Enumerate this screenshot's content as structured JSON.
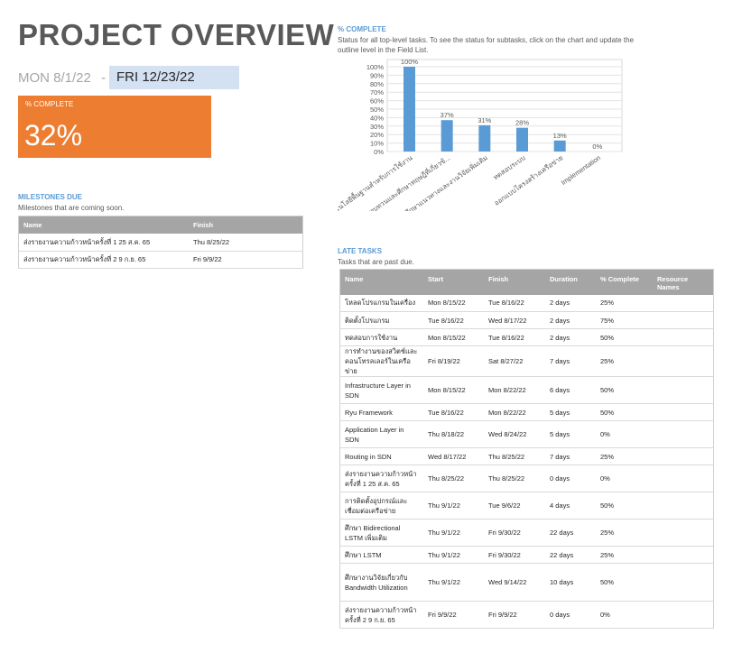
{
  "header": {
    "title": "PROJECT OVERVIEW",
    "start_date": "MON 8/1/22",
    "separator": "-",
    "finish_date": "FRI 12/23/22"
  },
  "percent_card": {
    "label": "% COMPLETE",
    "value": "32%"
  },
  "milestones": {
    "title": "MILESTONES DUE",
    "subtitle": "Milestones that are coming soon.",
    "columns": [
      "Name",
      "Finish"
    ],
    "rows": [
      [
        "ส่งรายงานความก้าวหน้าครั้งที่ 1 25 ส.ค. 65",
        "Thu 8/25/22"
      ],
      [
        "ส่งรายงานความก้าวหน้าครั้งที่ 2 9 ก.ย. 65",
        "Fri 9/9/22"
      ]
    ]
  },
  "complete_section": {
    "title": "% COMPLETE",
    "subtitle": "Status for all top-level tasks. To see the status for subtasks, click on the chart and update the outline level in the Field List."
  },
  "chart_data": {
    "type": "bar",
    "categories": [
      "ศึกษาเทคโนโลยีพื้นฐานสำหรับการใช้งาน",
      "ทบทวนและศึกษาทฤษฎีที่เกี่ยวข้...",
      "ศึกษาแนวทางและงานวิจัยเพิ่มเติม",
      "ทดสอบระบบ",
      "ออกแบบโครงสร้างเครือข่าย",
      "Implementation"
    ],
    "values": [
      100,
      37,
      31,
      28,
      13,
      0
    ],
    "data_labels": [
      "100%",
      "37%",
      "31%",
      "28%",
      "13%",
      "0%"
    ],
    "y_ticks": [
      "0%",
      "10%",
      "20%",
      "30%",
      "40%",
      "50%",
      "60%",
      "70%",
      "80%",
      "90%",
      "100%"
    ],
    "ylim": [
      0,
      100
    ],
    "grid": true,
    "bar_color": "#5b9bd5"
  },
  "late_tasks": {
    "title": "LATE TASKS",
    "subtitle": "Tasks that are past due.",
    "columns": [
      "Name",
      "Start",
      "Finish",
      "Duration",
      "% Complete",
      "Resource Names"
    ],
    "rows": [
      [
        "โหลดโปรแกรมในเครื่อง",
        "Mon 8/15/22",
        "Tue 8/16/22",
        "2 days",
        "25%",
        ""
      ],
      [
        "ติดตั้งโปรแกรม",
        "Tue 8/16/22",
        "Wed 8/17/22",
        "2 days",
        "75%",
        ""
      ],
      [
        "ทดสอบการใช้งาน",
        "Mon 8/15/22",
        "Tue 8/16/22",
        "2 days",
        "50%",
        ""
      ],
      [
        "การทำงานของสวิตช์และคอนโทรลเลอร์ในเครือข่าย",
        "Fri 8/19/22",
        "Sat 8/27/22",
        "7 days",
        "25%",
        ""
      ],
      [
        "Infrastructure Layer in SDN",
        "Mon 8/15/22",
        "Mon 8/22/22",
        "6 days",
        "50%",
        ""
      ],
      [
        "Ryu Framework",
        "Tue 8/16/22",
        "Mon 8/22/22",
        "5 days",
        "50%",
        ""
      ],
      [
        "Application Layer in SDN",
        "Thu 8/18/22",
        "Wed 8/24/22",
        "5 days",
        "0%",
        ""
      ],
      [
        "Routing in SDN",
        "Wed 8/17/22",
        "Thu 8/25/22",
        "7 days",
        "25%",
        ""
      ],
      [
        "ส่งรายงานความก้าวหน้าครั้งที่ 1 25 ส.ค. 65",
        "Thu 8/25/22",
        "Thu 8/25/22",
        "0 days",
        "0%",
        ""
      ],
      [
        "การติดตั้งอุปกรณ์และเชื่อมต่อเครือข่าย",
        "Thu 9/1/22",
        "Tue 9/6/22",
        "4 days",
        "50%",
        ""
      ],
      [
        "ศึกษา Bidirectional LSTM เพิ่มเติม",
        "Thu 9/1/22",
        "Fri 9/30/22",
        "22 days",
        "25%",
        ""
      ],
      [
        "ศึกษา LSTM",
        "Thu 9/1/22",
        "Fri 9/30/22",
        "22 days",
        "25%",
        ""
      ],
      [
        "ศึกษางานวิจัยเกี่ยวกับ Bandwidth Utilization",
        "Thu 9/1/22",
        "Wed 9/14/22",
        "10 days",
        "50%",
        ""
      ],
      [
        "ส่งรายงานความก้าวหน้าครั้งที่ 2 9 ก.ย. 65",
        "Fri 9/9/22",
        "Fri 9/9/22",
        "0 days",
        "0%",
        ""
      ]
    ]
  }
}
